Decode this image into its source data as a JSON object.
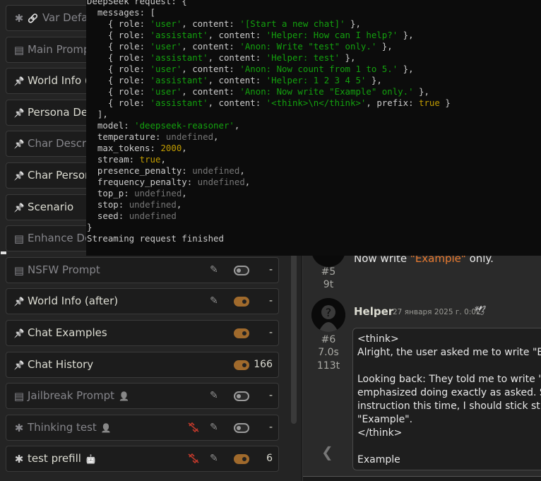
{
  "prompt_manager": {
    "rows": [
      {
        "label": "Var Defa",
        "type_icon": "asterisk-icon",
        "extra_icon": "link-icon",
        "enabled": false
      },
      {
        "label": "Main Promp",
        "type_icon": "document-icon",
        "enabled": false
      },
      {
        "label": "World Info (",
        "type_icon": "pin-icon",
        "enabled": true
      },
      {
        "label": "Persona Des",
        "type_icon": "pin-icon",
        "enabled": true
      },
      {
        "label": "Char Descrip",
        "type_icon": "pin-icon",
        "enabled": false
      },
      {
        "label": "Char Person",
        "type_icon": "pin-icon",
        "enabled": true
      },
      {
        "label": "Scenario",
        "type_icon": "pin-icon",
        "enabled": true
      },
      {
        "label": "Enhance De",
        "type_icon": "document-icon",
        "enabled": false
      },
      {
        "label": "NSFW Prompt",
        "type_icon": "document-icon",
        "enabled": false,
        "edit": true,
        "toggle_on": false,
        "tokens": "-"
      },
      {
        "label": "World Info (after)",
        "type_icon": "pin-icon",
        "enabled": true,
        "edit": true,
        "toggle_on": true,
        "tokens": "-"
      },
      {
        "label": "Chat Examples",
        "type_icon": "pin-icon",
        "enabled": true,
        "toggle_on": true,
        "tokens": "-"
      },
      {
        "label": "Chat History",
        "type_icon": "pin-icon",
        "enabled": true,
        "toggle_on": true,
        "tokens": "166"
      },
      {
        "label": "Jailbreak Prompt",
        "type_icon": "document-icon",
        "badge": "user-icon",
        "enabled": false,
        "edit": true,
        "toggle_on": false,
        "tokens": "-"
      },
      {
        "label": "Thinking test",
        "type_icon": "asterisk-icon",
        "badge": "user-icon",
        "enabled": false,
        "unlink": true,
        "edit": true,
        "toggle_on": false,
        "tokens": "-"
      },
      {
        "label": "test prefill",
        "type_icon": "asterisk-icon",
        "badge": "robot-icon",
        "enabled": true,
        "unlink": true,
        "edit": true,
        "toggle_on": true,
        "tokens": "6"
      }
    ]
  },
  "console": {
    "lines": [
      "DeepSeek request: {",
      "  messages: [",
      "    { role: 'user', content: '[Start a new chat]' },",
      "    { role: 'assistant', content: 'Helper: How can I help?' },",
      "    { role: 'user', content: 'Anon: Write \"test\" only.' },",
      "    { role: 'assistant', content: 'Helper: test' },",
      "    { role: 'user', content: 'Anon: Now count from 1 to 5.' },",
      "    { role: 'assistant', content: 'Helper: 1 2 3 4 5' },",
      "    { role: 'user', content: 'Anon: Now write \"Example\" only.' },",
      "    { role: 'assistant', content: '<think>\\n</think>', prefix: true }",
      "  ],",
      "  model: 'deepseek-reasoner',",
      "  temperature: undefined,",
      "  max_tokens: 2000,",
      "  stream: true,",
      "  presence_penalty: undefined,",
      "  frequency_penalty: undefined,",
      "  top_p: undefined,",
      "  stop: undefined,",
      "  seed: undefined",
      "}",
      "Streaming request finished"
    ]
  },
  "chat": {
    "prev_message": {
      "text_before": "Now write ",
      "quoted": "\"Example\"",
      "text_after": " only.",
      "id": "#5",
      "tokens": "9t"
    },
    "reply": {
      "author": "Helper",
      "timestamp": "27 января 2025 г. 0:02",
      "id": "#6",
      "duration": "7.0s",
      "tokens": "113t",
      "body": "<think>\nAlright, the user asked me to write \"E\n\nLooking back: They told me to write \"\nemphasized doing exactly as asked. S\ninstruction this time, I should stick st\n\"Example\".\n</think>\n\nExample"
    }
  },
  "colors": {
    "console_string": "#13a10e",
    "console_number": "#c19c00",
    "console_undefined": "#767676",
    "toggle_on": "#a06a2c",
    "quote": "#e87a30"
  }
}
